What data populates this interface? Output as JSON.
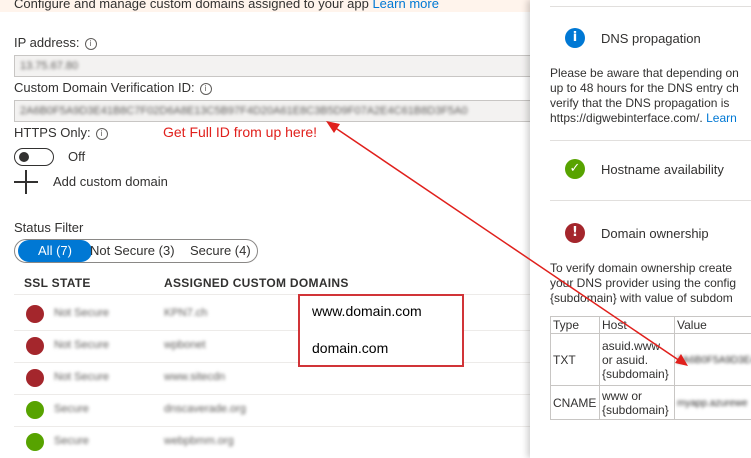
{
  "header": {
    "text": "Configure and manage custom domains assigned to your app",
    "link": "Learn more"
  },
  "ip": {
    "label": "IP address:",
    "value": "13.75.67.80"
  },
  "verification": {
    "label": "Custom Domain Verification ID:",
    "value": "2A6B0F5A9D3E41B8C7F02D6A8E13C5B97F4D20A61E8C3B5D9F07A2E4C61B8D3F5A0"
  },
  "annotation": "Get Full ID from up here!",
  "https": {
    "label": "HTTPS Only:",
    "state_label": "Off"
  },
  "add_domain": {
    "label": "Add custom domain",
    "icon": "plus-icon"
  },
  "status_filter": {
    "label": "Status Filter",
    "options": [
      "All (7)",
      "Not Secure (3)",
      "Secure (4)"
    ],
    "selected": "All (7)"
  },
  "table": {
    "columns": [
      "SSL STATE",
      "ASSIGNED CUSTOM DOMAINS"
    ],
    "rows": [
      {
        "state": "Not Secure",
        "status": "error",
        "domain": "KPN7.ch"
      },
      {
        "state": "Not Secure",
        "status": "error",
        "domain": "wpbonet"
      },
      {
        "state": "Not Secure",
        "status": "error",
        "domain": "www.sitecdn"
      },
      {
        "state": "Secure",
        "status": "ok",
        "domain": "dnscaverade.org"
      },
      {
        "state": "Secure",
        "status": "ok",
        "domain": "webpbmm.org"
      }
    ]
  },
  "callout": {
    "line1": "www.domain.com",
    "line2": "domain.com"
  },
  "side_panel": {
    "dns": {
      "title": "DNS propagation",
      "lines": [
        "Please be aware that depending on",
        "up to 48 hours for the DNS entry ch",
        "verify that the DNS propagation is"
      ],
      "url": "https://digwebinterface.com/.",
      "link": "Learn"
    },
    "hostname": {
      "title": "Hostname availability"
    },
    "ownership": {
      "title": "Domain ownership",
      "lines": [
        "To verify domain ownership create",
        "your DNS provider using the config",
        "{subdomain} with value of subdom"
      ],
      "table": {
        "headers": [
          "Type",
          "Host",
          "Value"
        ],
        "rows": [
          {
            "type": "TXT",
            "host": "asuid.www or asuid. {subdomain}",
            "value": "2A6B0F5A9D3E41B8"
          },
          {
            "type": "CNAME",
            "host": "www or {subdomain}",
            "value": "myapp.azurewe"
          }
        ]
      }
    }
  },
  "colors": {
    "accent": "#0078d4",
    "error": "#a4262c",
    "success": "#57a300",
    "annotation": "#e0201c"
  }
}
